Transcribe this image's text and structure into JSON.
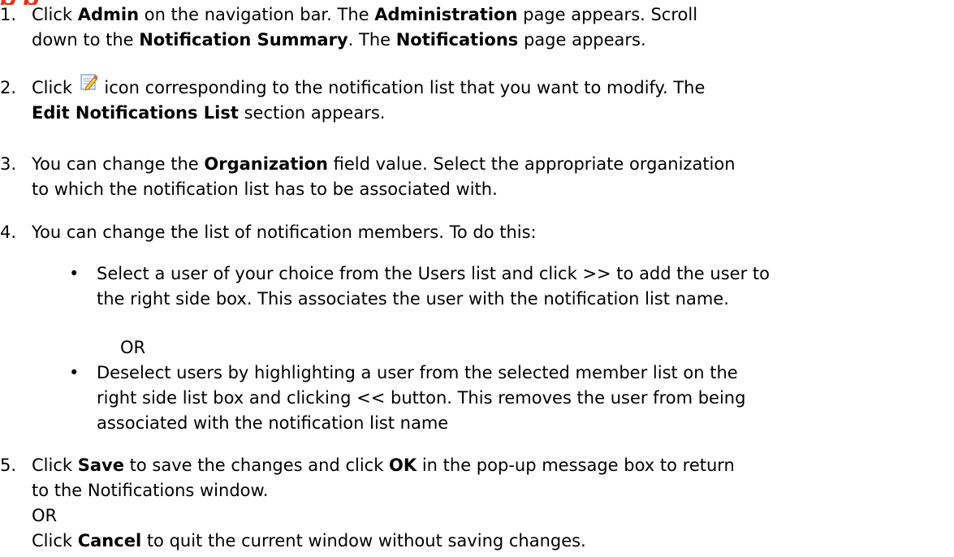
{
  "header": {
    "partial_title": "p  p"
  },
  "steps": [
    {
      "number": "1.",
      "lines": [
        [
          {
            "t": "Click "
          },
          {
            "t": "Admin",
            "b": true
          },
          {
            "t": " on the navigation bar. The "
          },
          {
            "t": "Administration",
            "b": true
          },
          {
            "t": " page appears. Scroll"
          }
        ],
        [
          {
            "t": "down to the "
          },
          {
            "t": "Notification Summary",
            "b": true
          },
          {
            "t": ". The "
          },
          {
            "t": "Notifications",
            "b": true
          },
          {
            "t": " page appears."
          }
        ]
      ]
    },
    {
      "number": "2.",
      "before_icon": "Click ",
      "icon": "edit-icon",
      "after_icon": " icon corresponding to the notification list that you want to modify. The",
      "line2_bold": "Edit Notifications List",
      "line2_rest": " section appears."
    },
    {
      "number": "3.",
      "lines": [
        [
          {
            "t": "You can change the "
          },
          {
            "t": "Organization",
            "b": true
          },
          {
            "t": " field value. Select the appropriate organization"
          }
        ],
        [
          {
            "t": "to which the notification list has to be associated with."
          }
        ]
      ]
    },
    {
      "number": "4.",
      "intro": "You can change the list of notification members. To do this:",
      "bullets": [
        {
          "symbol": "•",
          "lines": [
            "Select a user of your choice from the Users list and click >> to add the user to",
            "the right side box. This associates the user with the notification list name."
          ]
        },
        {
          "symbol": "•",
          "lines": [
            "Deselect users by highlighting a user from the selected member list on the",
            "right side list box and clicking << button. This removes the user from being",
            "associated with the notification list name"
          ]
        }
      ],
      "or_between": "OR"
    },
    {
      "number": "5.",
      "lines": [
        [
          {
            "t": "Click "
          },
          {
            "t": "Save",
            "b": true
          },
          {
            "t": " to save the changes and click "
          },
          {
            "t": "OK",
            "b": true
          },
          {
            "t": " in the pop-up message box to return"
          }
        ],
        [
          {
            "t": "to the Notifications window."
          }
        ],
        [
          {
            "t": "OR"
          }
        ],
        [
          {
            "t": "Click "
          },
          {
            "t": "Cancel",
            "b": true
          },
          {
            "t": "  to quit the current window without saving changes."
          }
        ]
      ]
    }
  ],
  "colors": {
    "heading": "#e8311a",
    "text": "#000000",
    "background": "#ffffff"
  }
}
